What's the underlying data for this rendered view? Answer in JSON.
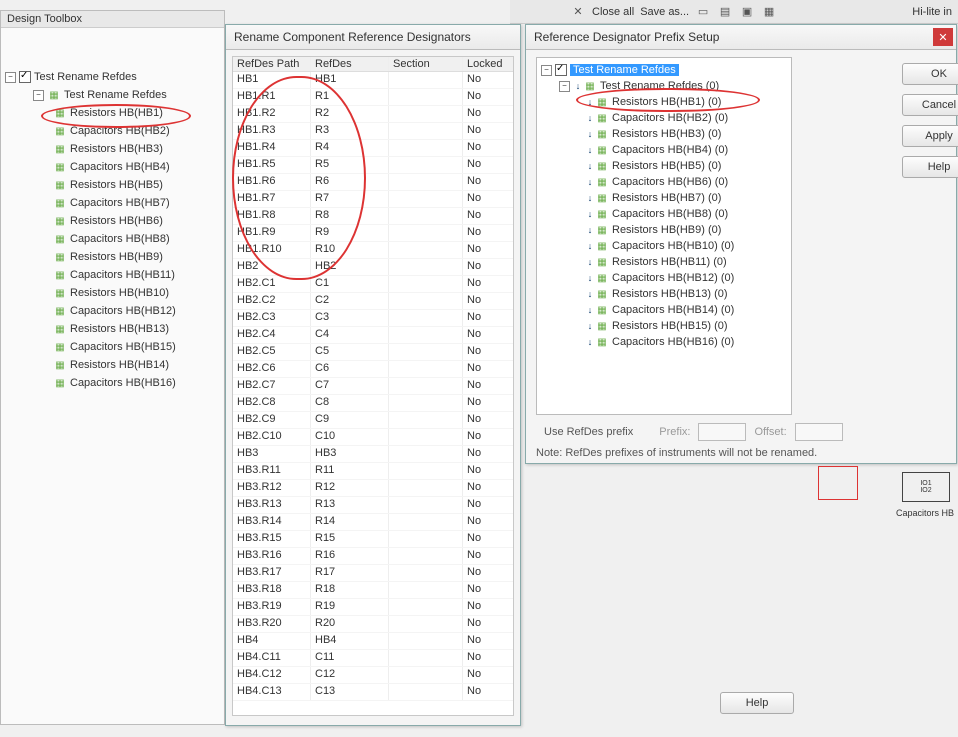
{
  "toolbar": {
    "items": [
      "Close all",
      "Save as..."
    ],
    "right_hint": "Hi-lite in"
  },
  "design_toolbox": {
    "title": "Design Toolbox",
    "root": "Test Rename Refdes",
    "root2": "Test Rename Refdes",
    "items": [
      "Resistors HB(HB1)",
      "Capacitors HB(HB2)",
      "Resistors HB(HB3)",
      "Capacitors HB(HB4)",
      "Resistors HB(HB5)",
      "Capacitors HB(HB7)",
      "Resistors HB(HB6)",
      "Capacitors HB(HB8)",
      "Resistors HB(HB9)",
      "Capacitors HB(HB11)",
      "Resistors HB(HB10)",
      "Capacitors HB(HB12)",
      "Resistors HB(HB13)",
      "Capacitors HB(HB15)",
      "Resistors HB(HB14)",
      "Capacitors HB(HB16)"
    ]
  },
  "rename_dialog": {
    "title": "Rename Component Reference Designators",
    "columns": [
      "RefDes Path",
      "RefDes",
      "Section",
      "Locked"
    ],
    "rows": [
      {
        "p": "HB1",
        "r": "HB1",
        "s": "",
        "l": "No"
      },
      {
        "p": "HB1.R1",
        "r": "R1",
        "s": "",
        "l": "No"
      },
      {
        "p": "HB1.R2",
        "r": "R2",
        "s": "",
        "l": "No"
      },
      {
        "p": "HB1.R3",
        "r": "R3",
        "s": "",
        "l": "No"
      },
      {
        "p": "HB1.R4",
        "r": "R4",
        "s": "",
        "l": "No"
      },
      {
        "p": "HB1.R5",
        "r": "R5",
        "s": "",
        "l": "No"
      },
      {
        "p": "HB1.R6",
        "r": "R6",
        "s": "",
        "l": "No"
      },
      {
        "p": "HB1.R7",
        "r": "R7",
        "s": "",
        "l": "No"
      },
      {
        "p": "HB1.R8",
        "r": "R8",
        "s": "",
        "l": "No"
      },
      {
        "p": "HB1.R9",
        "r": "R9",
        "s": "",
        "l": "No"
      },
      {
        "p": "HB1.R10",
        "r": "R10",
        "s": "",
        "l": "No"
      },
      {
        "p": "HB2",
        "r": "HB2",
        "s": "",
        "l": "No"
      },
      {
        "p": "HB2.C1",
        "r": "C1",
        "s": "",
        "l": "No"
      },
      {
        "p": "HB2.C2",
        "r": "C2",
        "s": "",
        "l": "No"
      },
      {
        "p": "HB2.C3",
        "r": "C3",
        "s": "",
        "l": "No"
      },
      {
        "p": "HB2.C4",
        "r": "C4",
        "s": "",
        "l": "No"
      },
      {
        "p": "HB2.C5",
        "r": "C5",
        "s": "",
        "l": "No"
      },
      {
        "p": "HB2.C6",
        "r": "C6",
        "s": "",
        "l": "No"
      },
      {
        "p": "HB2.C7",
        "r": "C7",
        "s": "",
        "l": "No"
      },
      {
        "p": "HB2.C8",
        "r": "C8",
        "s": "",
        "l": "No"
      },
      {
        "p": "HB2.C9",
        "r": "C9",
        "s": "",
        "l": "No"
      },
      {
        "p": "HB2.C10",
        "r": "C10",
        "s": "",
        "l": "No"
      },
      {
        "p": "HB3",
        "r": "HB3",
        "s": "",
        "l": "No"
      },
      {
        "p": "HB3.R11",
        "r": "R11",
        "s": "",
        "l": "No"
      },
      {
        "p": "HB3.R12",
        "r": "R12",
        "s": "",
        "l": "No"
      },
      {
        "p": "HB3.R13",
        "r": "R13",
        "s": "",
        "l": "No"
      },
      {
        "p": "HB3.R14",
        "r": "R14",
        "s": "",
        "l": "No"
      },
      {
        "p": "HB3.R15",
        "r": "R15",
        "s": "",
        "l": "No"
      },
      {
        "p": "HB3.R16",
        "r": "R16",
        "s": "",
        "l": "No"
      },
      {
        "p": "HB3.R17",
        "r": "R17",
        "s": "",
        "l": "No"
      },
      {
        "p": "HB3.R18",
        "r": "R18",
        "s": "",
        "l": "No"
      },
      {
        "p": "HB3.R19",
        "r": "R19",
        "s": "",
        "l": "No"
      },
      {
        "p": "HB3.R20",
        "r": "R20",
        "s": "",
        "l": "No"
      },
      {
        "p": "HB4",
        "r": "HB4",
        "s": "",
        "l": "No"
      },
      {
        "p": "HB4.C11",
        "r": "C11",
        "s": "",
        "l": "No"
      },
      {
        "p": "HB4.C12",
        "r": "C12",
        "s": "",
        "l": "No"
      },
      {
        "p": "HB4.C13",
        "r": "C13",
        "s": "",
        "l": "No"
      }
    ]
  },
  "prefix_dialog": {
    "title": "Reference Designator Prefix Setup",
    "root": "Test Rename Refdes",
    "sub": "Test Rename Refdes (0)",
    "items": [
      "Resistors HB(HB1) (0)",
      "Capacitors HB(HB2) (0)",
      "Resistors HB(HB3) (0)",
      "Capacitors HB(HB4) (0)",
      "Resistors HB(HB5) (0)",
      "Capacitors HB(HB6) (0)",
      "Resistors HB(HB7) (0)",
      "Capacitors HB(HB8) (0)",
      "Resistors HB(HB9) (0)",
      "Capacitors HB(HB10) (0)",
      "Resistors HB(HB11) (0)",
      "Capacitors HB(HB12) (0)",
      "Resistors HB(HB13) (0)",
      "Capacitors HB(HB14) (0)",
      "Resistors HB(HB15) (0)",
      "Capacitors HB(HB16) (0)"
    ],
    "use_refdes_prefix": "Use RefDes prefix",
    "prefix_label": "Prefix:",
    "offset_label": "Offset:",
    "note": "Note: RefDes prefixes of instruments will not be renamed.",
    "buttons": {
      "ok": "OK",
      "cancel": "Cancel",
      "apply": "Apply",
      "help": "Help"
    }
  },
  "help_label": "Help",
  "schematic": {
    "label": "Capacitors HB"
  }
}
